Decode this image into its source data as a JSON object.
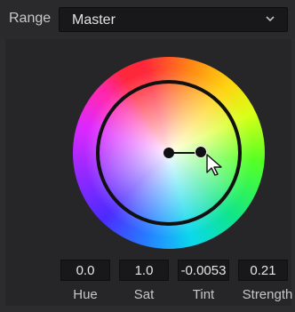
{
  "header": {
    "range_label": "Range",
    "range_value": "Master",
    "dropdown_icon": "chevron-down-icon"
  },
  "wheel": {
    "center_icon": "center-dot-icon",
    "handle_icon": "color-handle-icon",
    "cursor_icon": "arrow-cursor-icon",
    "colors": {
      "ring": "#111111",
      "background": "#2c2c2e"
    }
  },
  "params": {
    "values": {
      "hue": "0.0",
      "sat": "1.0",
      "tint": "-0.0053",
      "strength": "0.21"
    },
    "labels": {
      "hue": "Hue",
      "sat": "Sat",
      "tint": "Tint",
      "strength": "Strength"
    }
  }
}
